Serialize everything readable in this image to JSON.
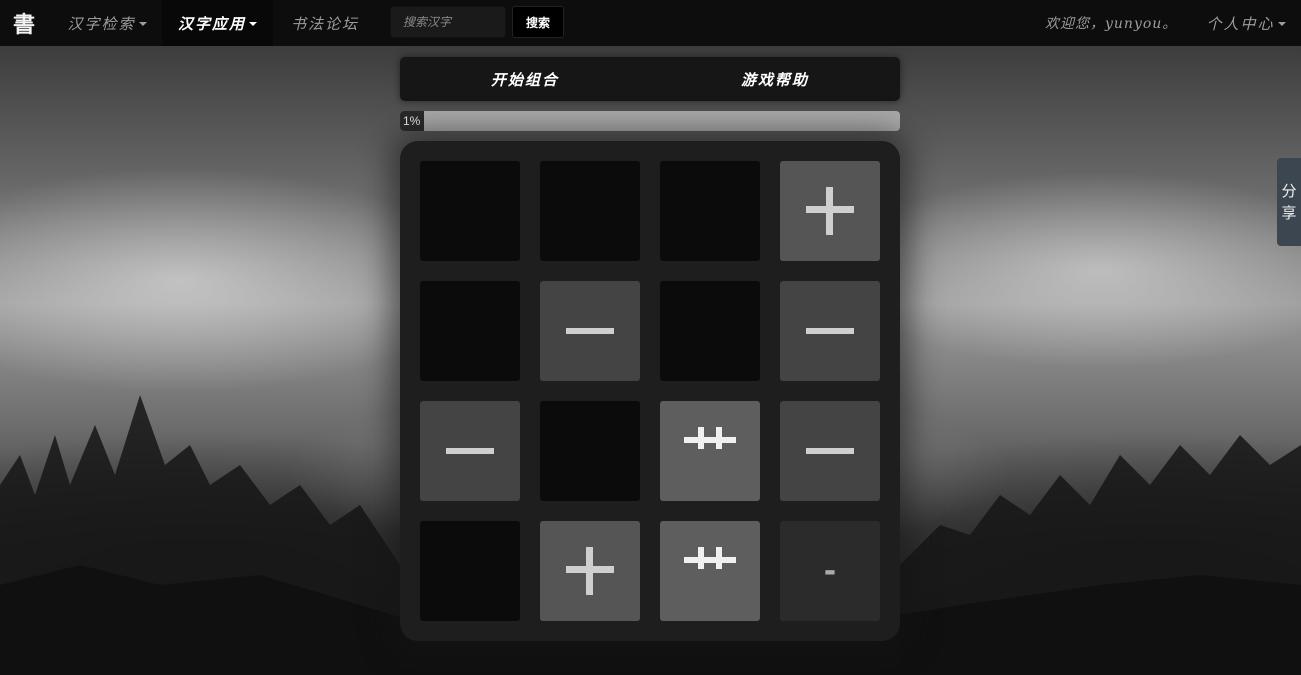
{
  "navbar": {
    "brand": "書",
    "items": [
      {
        "label": "汉字检索",
        "dropdown": true,
        "active": false
      },
      {
        "label": "汉字应用",
        "dropdown": true,
        "active": true
      },
      {
        "label": "书法论坛",
        "dropdown": false,
        "active": false
      }
    ],
    "search_placeholder": "搜索汉字",
    "search_button": "搜索",
    "welcome": "欢迎您，yunyou。",
    "user_menu": "个人中心"
  },
  "game": {
    "start_button": "开始组合",
    "help_button": "游戏帮助",
    "progress_percent": 1,
    "progress_label": "1%",
    "grid": [
      [
        {
          "glyph": "",
          "style": "empty"
        },
        {
          "glyph": "",
          "style": "empty"
        },
        {
          "glyph": "",
          "style": "empty"
        },
        {
          "glyph": "plus",
          "style": "t4"
        }
      ],
      [
        {
          "glyph": "",
          "style": "empty"
        },
        {
          "glyph": "dash",
          "style": "t2"
        },
        {
          "glyph": "",
          "style": "empty"
        },
        {
          "glyph": "dash",
          "style": "t2"
        }
      ],
      [
        {
          "glyph": "dash",
          "style": "t2"
        },
        {
          "glyph": "",
          "style": "empty"
        },
        {
          "glyph": "double-plus",
          "style": "t8"
        },
        {
          "glyph": "dash",
          "style": "t2"
        }
      ],
      [
        {
          "glyph": "",
          "style": "empty"
        },
        {
          "glyph": "plus",
          "style": "t4"
        },
        {
          "glyph": "double-plus",
          "style": "t8"
        },
        {
          "glyph": "-",
          "style": "t1"
        }
      ]
    ]
  },
  "share": {
    "label_1": "分",
    "label_2": "享"
  }
}
